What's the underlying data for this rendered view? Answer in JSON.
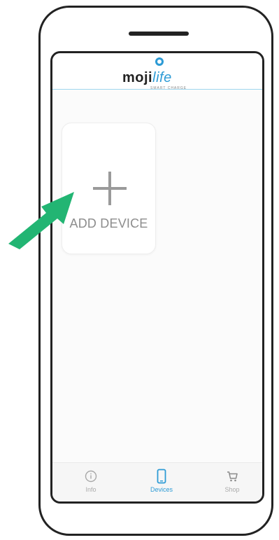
{
  "app": {
    "logo_main": "moji",
    "logo_accent": "life",
    "logo_tagline": "SMART CHARGE"
  },
  "main": {
    "add_device_label": "ADD DEVICE"
  },
  "nav": {
    "items": [
      {
        "label": "Info",
        "icon": "info-icon",
        "active": false
      },
      {
        "label": "Devices",
        "icon": "device-icon",
        "active": true
      },
      {
        "label": "Shop",
        "icon": "cart-icon",
        "active": false
      }
    ]
  },
  "colors": {
    "brand_blue": "#2d9bd5",
    "arrow_green": "#22b573",
    "frame": "#222222"
  }
}
